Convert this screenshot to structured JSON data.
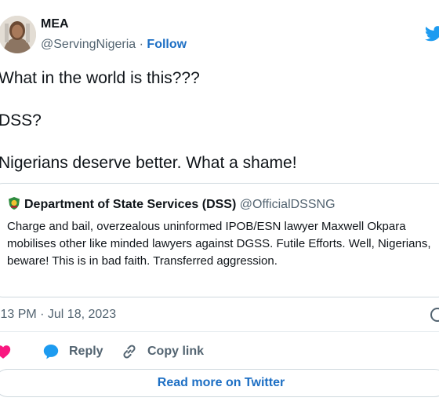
{
  "author": {
    "name": "MEA",
    "handle": "@ServingNigeria",
    "separator": "·",
    "follow_label": "Follow"
  },
  "tweet": {
    "lines": [
      "What in the world is this???",
      "DSS?",
      "Nigerians deserve better. What a shame!"
    ],
    "timestamp": ":13 PM · Jul 18, 2023"
  },
  "quote": {
    "author": "Department of State Services (DSS)",
    "handle": "@OfficialDSSNG",
    "text": "Charge and bail, overzealous uninformed IPOB/ESN lawyer Maxwell Okpara mobilises other like minded lawyers against DGSS. Futile Efforts. Well, Nigerians, beware! This is in bad faith. Transferred aggression."
  },
  "actions": {
    "reply_label": "Reply",
    "copy_label": "Copy link"
  },
  "footer": {
    "read_more_label": "Read more on Twitter"
  },
  "icons": {
    "brand": "twitter-bird-icon",
    "like": "heart-icon",
    "reply": "speech-bubble-icon",
    "copy": "link-icon",
    "info": "info-icon"
  },
  "colors": {
    "link": "#1d6fc4",
    "like": "#f91880",
    "twitter": "#1d9bf0",
    "secondary_text": "#536471",
    "border": "#cfd9de"
  }
}
